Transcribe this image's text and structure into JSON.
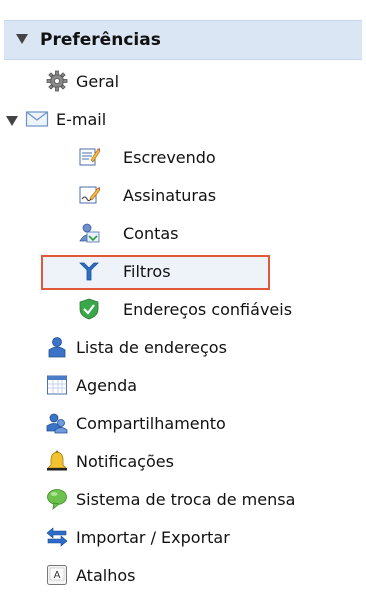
{
  "tree": {
    "header": {
      "label": "Preferências"
    },
    "items": [
      {
        "label": "Geral",
        "icon": "gear-icon"
      },
      {
        "label": "E-mail",
        "icon": "envelope-icon"
      },
      {
        "label": "Escrevendo",
        "icon": "compose-icon"
      },
      {
        "label": "Assinaturas",
        "icon": "signature-icon"
      },
      {
        "label": "Contas",
        "icon": "accounts-icon"
      },
      {
        "label": "Filtros",
        "icon": "filter-icon"
      },
      {
        "label": "Endereços confiáveis",
        "icon": "shield-check-icon"
      },
      {
        "label": "Lista de endereços",
        "icon": "contact-icon"
      },
      {
        "label": "Agenda",
        "icon": "calendar-icon"
      },
      {
        "label": "Compartilhamento",
        "icon": "share-users-icon"
      },
      {
        "label": "Notificações",
        "icon": "bell-icon"
      },
      {
        "label": "Sistema de troca de mensa",
        "icon": "chat-bubble-icon"
      },
      {
        "label": "Importar / Exportar",
        "icon": "import-export-icon"
      },
      {
        "label": "Atalhos",
        "icon": "keyboard-key-icon"
      }
    ]
  },
  "colors": {
    "header_bg": "#dbe6f4",
    "selection_border": "#e2583a"
  }
}
